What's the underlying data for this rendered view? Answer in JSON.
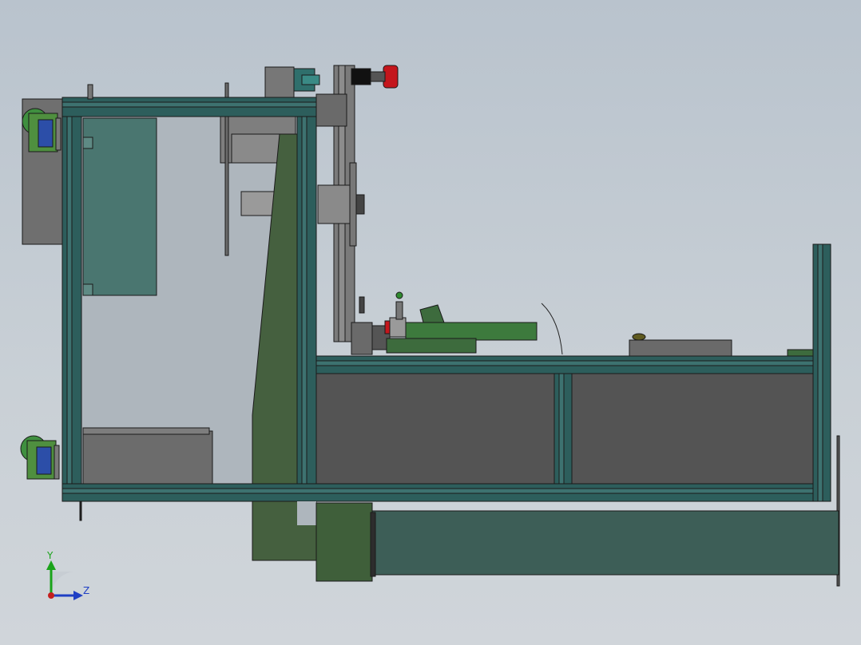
{
  "view": {
    "background_color": "#c4ccd4"
  },
  "triad": {
    "y_label": "Y",
    "z_label": "Z",
    "y_color": "#1aa31a",
    "z_color": "#1f3fc4",
    "x_color": "#c41f1f"
  },
  "model": {
    "frame_color": "#2d5e5c",
    "panel_color": "#545454",
    "green_part_color": "#3d6b3d",
    "red_part_color": "#c4161c",
    "glass_color": "#a9b2ba"
  }
}
